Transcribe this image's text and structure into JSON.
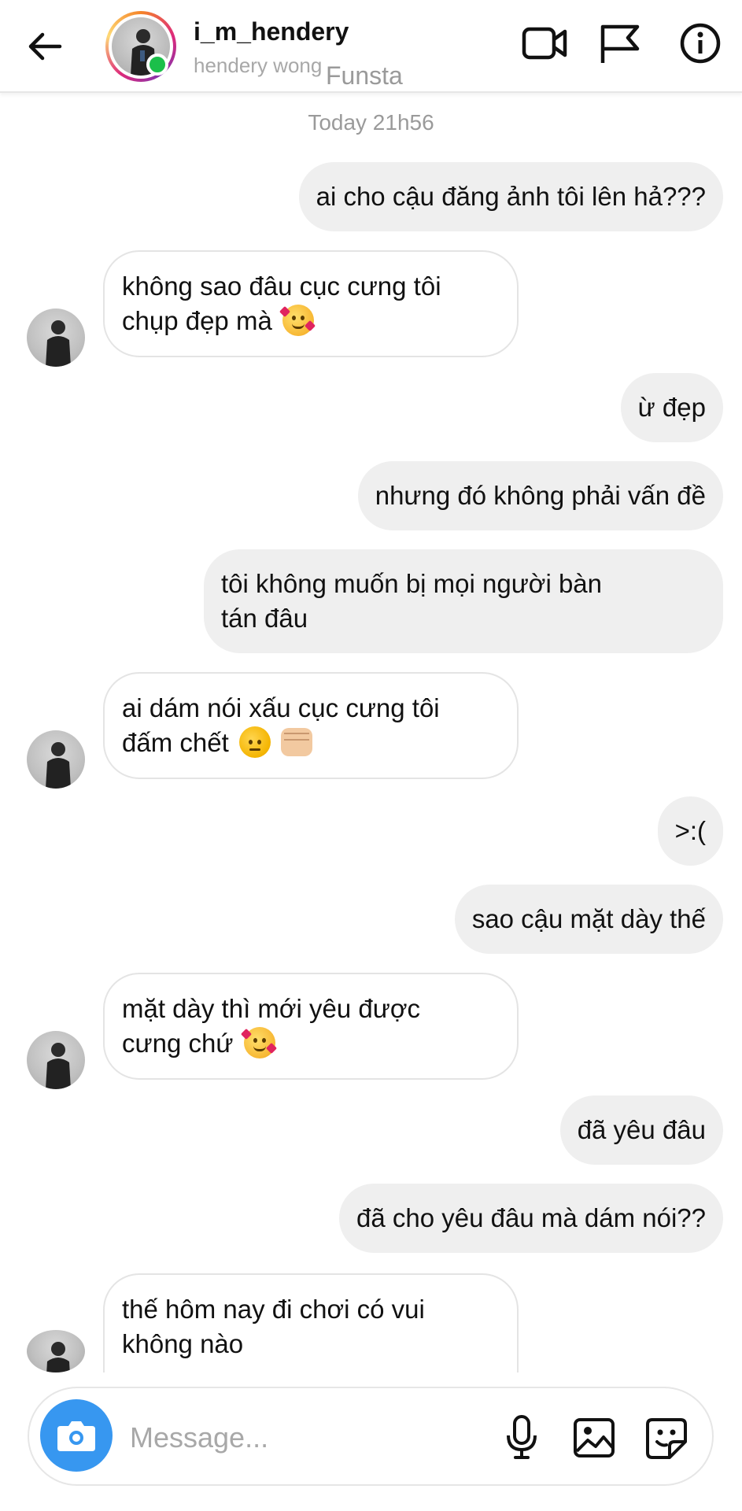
{
  "header": {
    "username": "i_m_hendery",
    "full_name": "hendery wong",
    "watermark": "Funsta",
    "online": true
  },
  "chat": {
    "timestamp": "Today 21h56",
    "messages": [
      {
        "from": "me",
        "text": "ai cho cậu đăng ảnh tôi lên hả???"
      },
      {
        "from": "them",
        "lines": [
          "không sao đâu cục cưng tôi",
          "chụp đẹp mà"
        ],
        "emoji": "smiling-face-with-hearts"
      },
      {
        "from": "me",
        "text": "ừ đẹp"
      },
      {
        "from": "me",
        "text": "nhưng đó không phải vấn đề"
      },
      {
        "from": "me",
        "lines": [
          "tôi không muốn bị mọi người bàn",
          "tán đâu"
        ]
      },
      {
        "from": "them",
        "lines": [
          "ai dám nói xấu cục cưng tôi",
          "đấm chết"
        ],
        "emoji": "angry-face, oncoming-fist"
      },
      {
        "from": "me",
        "text": ">:("
      },
      {
        "from": "me",
        "text": "sao cậu mặt dày thế"
      },
      {
        "from": "them",
        "lines": [
          "mặt dày thì mới yêu được",
          "cưng chứ"
        ],
        "emoji": "smiling-face-with-hearts"
      },
      {
        "from": "me",
        "text": "đã yêu đâu"
      },
      {
        "from": "me",
        "text": "đã cho yêu đâu mà dám nói??"
      },
      {
        "from": "them",
        "lines": [
          "thế hôm nay đi chơi có vui",
          "không nào"
        ]
      }
    ]
  },
  "composer": {
    "placeholder": "Message..."
  },
  "icons": [
    "back-arrow-icon",
    "video-call-icon",
    "flag-icon",
    "info-icon",
    "camera-icon",
    "microphone-icon",
    "gallery-icon",
    "sticker-icon"
  ],
  "colors": {
    "outgoing_bubble": "#efefef",
    "incoming_border": "#e4e4e4",
    "camera_button": "#3797f0",
    "online_dot": "#1bbf4a",
    "muted_text": "#a8a8a8"
  }
}
